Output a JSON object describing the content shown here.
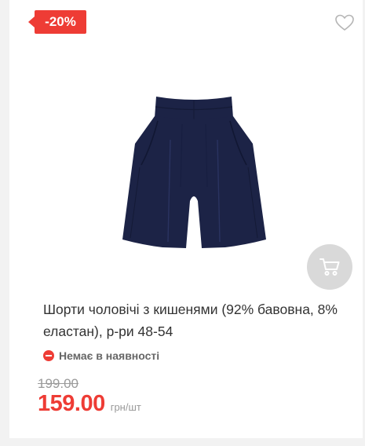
{
  "badge": {
    "discount": "-20%"
  },
  "icons": {
    "wishlist": "heart-icon",
    "cart": "cart-icon",
    "availability": "minus-circle-icon"
  },
  "product": {
    "title": "Шорти чоловічі з кишенями (92% бавовна, 8% еластан), р-ри 48-54",
    "availability": "Немає в наявності",
    "old_price": "199.00",
    "price": "159.00",
    "unit": "грн/шт"
  },
  "colors": {
    "accent": "#ee3c35",
    "product": "#1c2346",
    "cart_bg": "#d9d9d9"
  }
}
